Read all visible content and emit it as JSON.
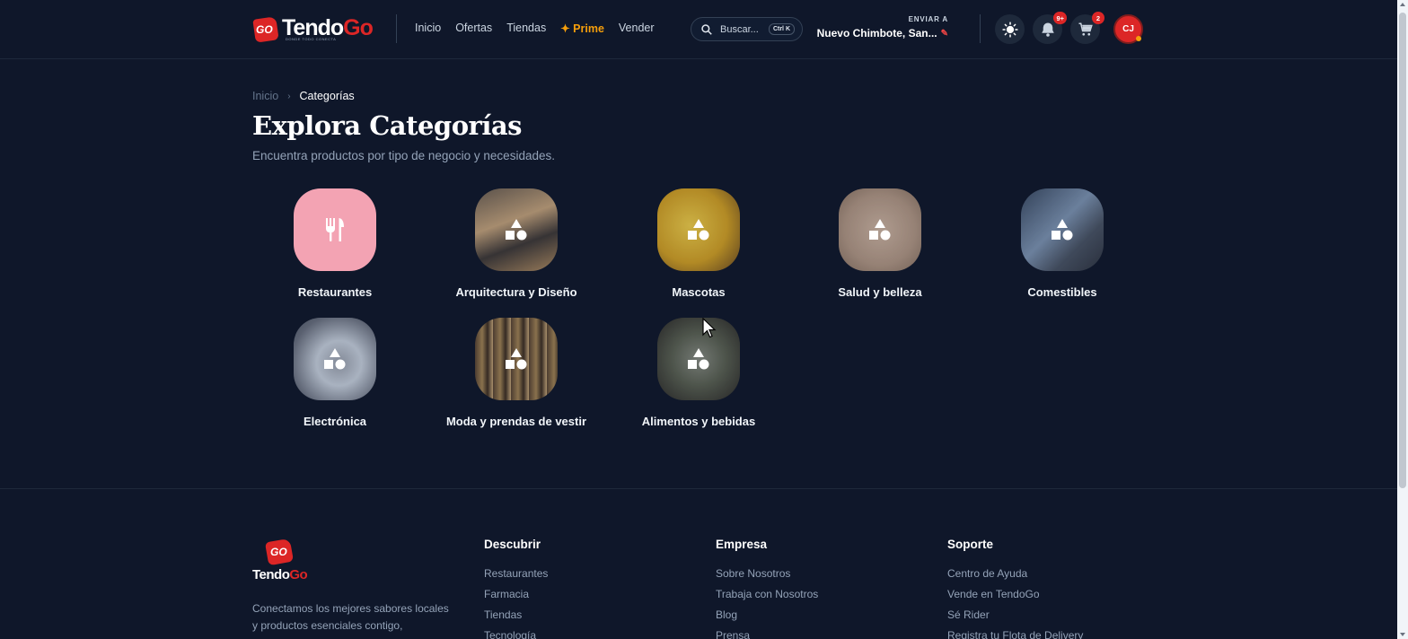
{
  "brand": {
    "name_part1": "Tendo",
    "name_part2": "Go",
    "badge": "GO",
    "tagline": "DONDE TODO CONECTA"
  },
  "nav": {
    "items": [
      "Inicio",
      "Ofertas",
      "Tiendas",
      "✦ Prime",
      "Vender"
    ]
  },
  "search": {
    "placeholder": "Buscar...",
    "shortcut": "Ctrl K"
  },
  "shipping": {
    "label": "ENVIAR A",
    "location": "Nuevo Chimbote, San..."
  },
  "header_actions": {
    "notifications_badge": "9+",
    "cart_badge": "2",
    "avatar_initials": "CJ"
  },
  "breadcrumb": {
    "home": "Inicio",
    "current": "Categorías"
  },
  "page": {
    "title": "Explora Categorías",
    "subtitle": "Encuentra productos por tipo de negocio y necesidades."
  },
  "categories": [
    {
      "name": "Restaurantes",
      "icon": "utensils-icon"
    },
    {
      "name": "Arquitectura y Diseño",
      "icon": "shapes-icon"
    },
    {
      "name": "Mascotas",
      "icon": "shapes-icon"
    },
    {
      "name": "Salud y belleza",
      "icon": "shapes-icon"
    },
    {
      "name": "Comestibles",
      "icon": "shapes-icon"
    },
    {
      "name": "Electrónica",
      "icon": "shapes-icon"
    },
    {
      "name": "Moda y prendas de vestir",
      "icon": "shapes-icon"
    },
    {
      "name": "Alimentos y bebidas",
      "icon": "shapes-icon"
    }
  ],
  "footer": {
    "logo_text_1": "Tendo",
    "logo_text_2": "Go",
    "logo_badge": "GO",
    "description": "Conectamos los mejores sabores locales y productos esenciales contigo,",
    "columns": [
      {
        "title": "Descubrir",
        "links": [
          "Restaurantes",
          "Farmacia",
          "Tiendas",
          "Tecnología"
        ]
      },
      {
        "title": "Empresa",
        "links": [
          "Sobre Nosotros",
          "Trabaja con Nosotros",
          "Blog",
          "Prensa"
        ]
      },
      {
        "title": "Soporte",
        "links": [
          "Centro de Ayuda",
          "Vende en TendoGo",
          "Sé Rider",
          "Registra tu Flota de Delivery"
        ]
      }
    ]
  },
  "colors": {
    "background": "#0f172a",
    "accent": "#dc2626",
    "prime": "#f59e0b"
  }
}
